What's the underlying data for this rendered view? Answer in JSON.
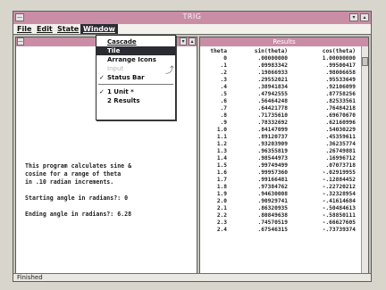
{
  "window": {
    "title": "TRIG",
    "sys_menu_icon": "minus-icon",
    "buttons": [
      "▾",
      "▴"
    ]
  },
  "menubar": {
    "items": [
      "File",
      "Edit",
      "State",
      "Window"
    ]
  },
  "window_menu": {
    "items": [
      {
        "label": "Cascade",
        "state": "normal"
      },
      {
        "label": "Tile",
        "state": "selected"
      },
      {
        "label": "Arrange Icons",
        "state": "normal"
      },
      {
        "label": "Input",
        "state": "disabled"
      },
      {
        "label": "Status Bar",
        "state": "checked"
      },
      {
        "label": "1 Unit *",
        "state": "checked"
      },
      {
        "label": "2 Results",
        "state": "normal"
      }
    ]
  },
  "left_window": {
    "scroll_buttons": [
      "▾",
      "▴"
    ],
    "text": {
      "line1": "This program calculates sine &",
      "line2": "cosine for a range of theta",
      "line3": "in .10 radian increments.",
      "line4": "Starting angle in radians?: 0",
      "line5": "Ending angle in radians?: 6.28"
    }
  },
  "results_window": {
    "title": "Results",
    "headers": [
      "theta",
      "sin(theta)",
      "cos(theta)"
    ],
    "rows": [
      [
        "0",
        ".00000000",
        "1.00000000"
      ],
      [
        ".1",
        ".09983342",
        ".99500417"
      ],
      [
        ".2",
        ".19866933",
        ".98006658"
      ],
      [
        ".3",
        ".29552021",
        ".95533649"
      ],
      [
        ".4",
        ".38941834",
        ".92106099"
      ],
      [
        ".5",
        ".47942555",
        ".87758256"
      ],
      [
        ".6",
        ".56464248",
        ".82533561"
      ],
      [
        ".7",
        ".64421778",
        ".76484218"
      ],
      [
        ".8",
        ".71735610",
        ".69670670"
      ],
      [
        ".9",
        ".78332692",
        ".62160996"
      ],
      [
        "1.0",
        ".84147099",
        ".54030229"
      ],
      [
        "1.1",
        ".89120737",
        ".45359611"
      ],
      [
        "1.2",
        ".93203909",
        ".36235774"
      ],
      [
        "1.3",
        ".96355819",
        ".26749881"
      ],
      [
        "1.4",
        ".98544973",
        ".16996712"
      ],
      [
        "1.5",
        ".99749499",
        ".07073718"
      ],
      [
        "1.6",
        ".99957360",
        "-.02919955"
      ],
      [
        "1.7",
        ".99166481",
        "-.12884452"
      ],
      [
        "1.8",
        ".97384762",
        "-.22720212"
      ],
      [
        "1.9",
        ".94630008",
        "-.32328954"
      ],
      [
        "2.0",
        ".90929741",
        "-.41614684"
      ],
      [
        "2.1",
        ".86320935",
        "-.50484613"
      ],
      [
        "2.2",
        ".80849638",
        "-.58850111"
      ],
      [
        "2.3",
        ".74570519",
        "-.66627605"
      ],
      [
        "2.4",
        ".67546315",
        "-.73739374"
      ]
    ]
  },
  "statusbar": {
    "text": "Finished"
  },
  "colors": {
    "titlebar": "#c98ea6",
    "selection": "#2b2b33"
  }
}
